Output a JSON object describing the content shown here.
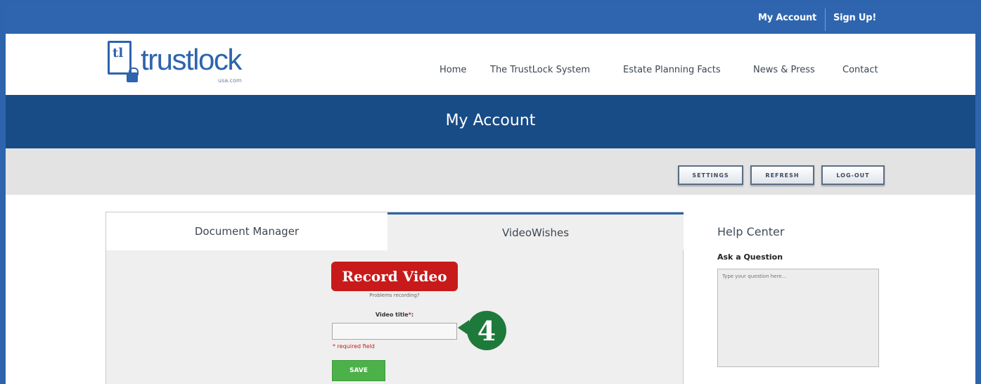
{
  "topbar": {
    "my_account": "My Account",
    "sign_up": "Sign Up!"
  },
  "logo": {
    "icon_text": "tl",
    "name": "trustlock",
    "sub": "usa.com"
  },
  "nav": {
    "items": [
      "Home",
      "The TrustLock System",
      "Estate Planning Facts",
      "News & Press",
      "Contact"
    ]
  },
  "page": {
    "title": "My Account"
  },
  "toolbar": {
    "settings": "SETTINGS",
    "refresh": "REFRESH",
    "logout": "LOG-OUT"
  },
  "tabs": {
    "document_manager": "Document Manager",
    "video_wishes": "VideoWishes"
  },
  "video": {
    "record_label": "Record Video",
    "problems_link": "Problems recording?",
    "title_label": "Video title",
    "required_star": "*",
    "colon": ":",
    "title_value": "",
    "required_note": "* required field",
    "save_label": "SAVE"
  },
  "callout": {
    "number": "4"
  },
  "help": {
    "title": "Help Center",
    "ask_label": "Ask a Question",
    "question_placeholder": "Type your question here..."
  },
  "colors": {
    "brand_blue": "#2d64ad",
    "title_band": "#184c87",
    "record_red": "#c81a1a",
    "save_green": "#4cb148",
    "callout_green": "#1e7a3a"
  }
}
